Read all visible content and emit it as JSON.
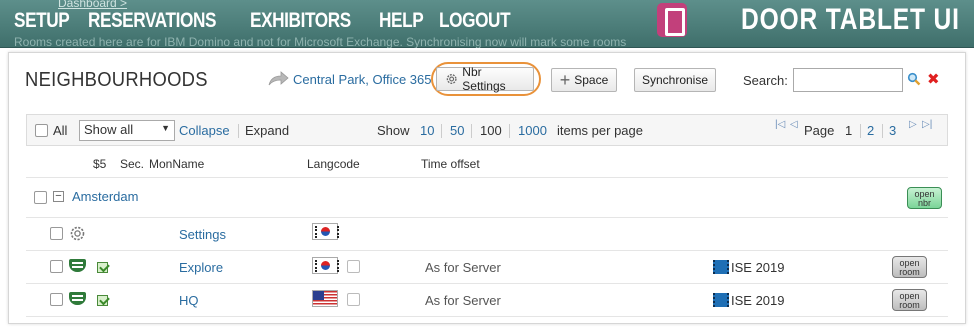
{
  "breadcrumb": "Dashboard >",
  "notice": "Rooms created here are for IBM Domino and not for Microsoft Exchange. Synchronising now will mark some rooms",
  "nav": {
    "setup": "SETUP",
    "reservations": "RESERVATIONS",
    "exhibitors": "EXHIBITORS",
    "help": "HELP",
    "logout": "LOGOUT"
  },
  "brand": "DOOR TABLET UI",
  "page": {
    "title": "NEIGHBOURHOODS",
    "location_link": "Central Park, Office 365",
    "nbr_settings_label": "Nbr Settings",
    "add_space_label": "Space",
    "synchronise_label": "Synchronise",
    "search_label": "Search:",
    "search_value": ""
  },
  "filter": {
    "all_label": "All",
    "show_select": "Show all",
    "collapse": "Collapse",
    "expand": "Expand",
    "show_label": "Show",
    "page_sizes": [
      "10",
      "50",
      "100",
      "1000"
    ],
    "items_per_page": "items per page",
    "page_label": "Page",
    "pages": [
      "1",
      "2",
      "3"
    ]
  },
  "table": {
    "headers": {
      "price": "$5",
      "sec": "Sec.",
      "mon_name": "MonName",
      "langcode": "Langcode",
      "time_offset": "Time offset"
    },
    "group": {
      "name": "Amsterdam",
      "open_label_1": "open",
      "open_label_2": "nbr"
    },
    "settings_row": {
      "name": "Settings"
    },
    "rows": [
      {
        "name": "Explore",
        "flag": "south-korea",
        "time_offset": "As for Server",
        "event": "ISE 2019",
        "open_1": "open",
        "open_2": "room"
      },
      {
        "name": "HQ",
        "flag": "usa",
        "time_offset": "As for Server",
        "event": "ISE 2019",
        "open_1": "open",
        "open_2": "room"
      }
    ]
  },
  "colors": {
    "topbar": "#4f807c",
    "link": "#2a6ca0",
    "highlight": "#e9923a",
    "close": "#e02020"
  }
}
